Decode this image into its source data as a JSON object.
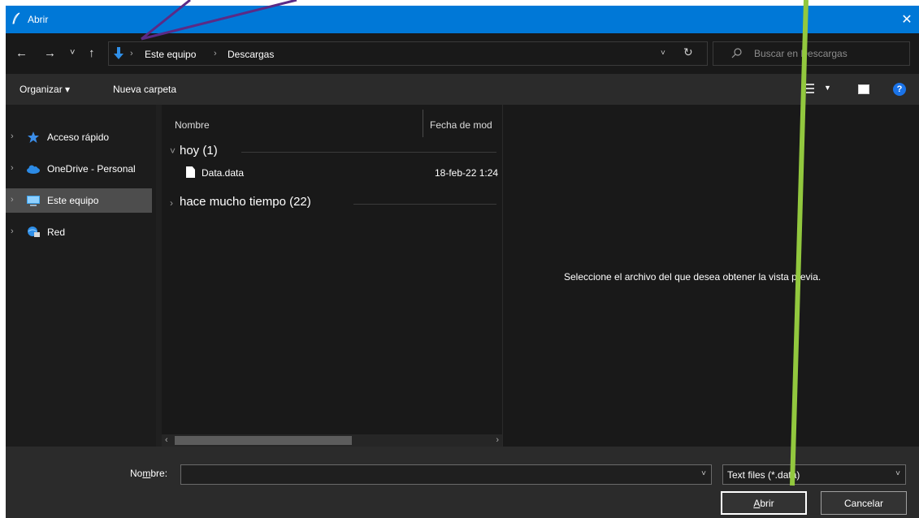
{
  "window": {
    "title": "Abrir",
    "close_glyph": "✕"
  },
  "nav": {
    "back_glyph": "←",
    "forward_glyph": "→",
    "recent_glyph": "˅",
    "up_glyph": "↑",
    "breadcrumbs": [
      "Este equipo",
      "Descargas"
    ],
    "separator": "›",
    "dropdown_glyph": "˅",
    "refresh_glyph": "↻"
  },
  "search": {
    "placeholder": "Buscar en Descargas"
  },
  "toolbar": {
    "organize_label": "Organizar ▾",
    "new_folder_label": "Nueva carpeta",
    "view_caret": "▼",
    "help_label": "?"
  },
  "sidebar": {
    "items": [
      {
        "label": "Acceso rápido",
        "icon": "star-icon"
      },
      {
        "label": "OneDrive - Personal",
        "icon": "cloud-icon"
      },
      {
        "label": "Este equipo",
        "icon": "computer-icon",
        "selected": true
      },
      {
        "label": "Red",
        "icon": "network-icon"
      }
    ],
    "chevron": "›"
  },
  "filelist": {
    "columns": [
      "Nombre",
      "Fecha de mod"
    ],
    "groups": [
      {
        "label": "hoy (1)",
        "expanded": true
      },
      {
        "label": "hace mucho tiempo (22)",
        "expanded": false
      }
    ],
    "files": [
      {
        "name": "Data.data",
        "date": "18-feb-22 1:24"
      }
    ],
    "scroll_left": "‹",
    "scroll_right": "›"
  },
  "preview": {
    "message": "Seleccione el archivo del que desea obtener la vista previa."
  },
  "bottom": {
    "filename_label_pre": "No",
    "filename_label_ul": "m",
    "filename_label_post": "bre:",
    "filename_value": "",
    "filter_value": "Text files (*.data)",
    "open_label_ul": "A",
    "open_label_rest": "brir",
    "cancel_label": "Cancelar",
    "caret": "˅"
  },
  "colors": {
    "accent": "#0078d7",
    "annotation_purple": "#5b2a86",
    "annotation_green": "#92c83e"
  }
}
